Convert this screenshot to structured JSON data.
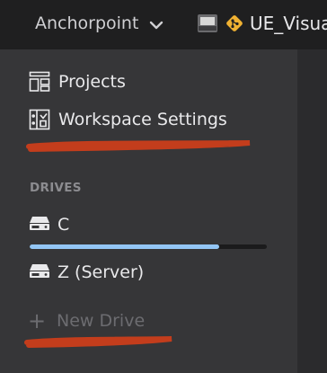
{
  "header": {
    "workspace_name": "Anchorpoint",
    "project_name": "UE_Visual"
  },
  "sidebar": {
    "nav_items": [
      {
        "label": "Projects",
        "icon": "projects-icon"
      },
      {
        "label": "Workspace Settings",
        "icon": "workspace-settings-icon"
      }
    ],
    "drives_heading": "DRIVES",
    "drives": [
      {
        "label": "C",
        "icon": "hard-drive-icon",
        "usage_fraction": 0.8
      },
      {
        "label": "Z (Server)",
        "icon": "hard-drive-icon"
      }
    ],
    "new_drive_label": "New Drive"
  },
  "colors": {
    "topbar_bg": "#1f1f20",
    "sidebar_bg": "#363638",
    "usage_fill": "#93c6f5",
    "annotation_underline": "#c33d1c",
    "git_icon": "#f0b132"
  }
}
